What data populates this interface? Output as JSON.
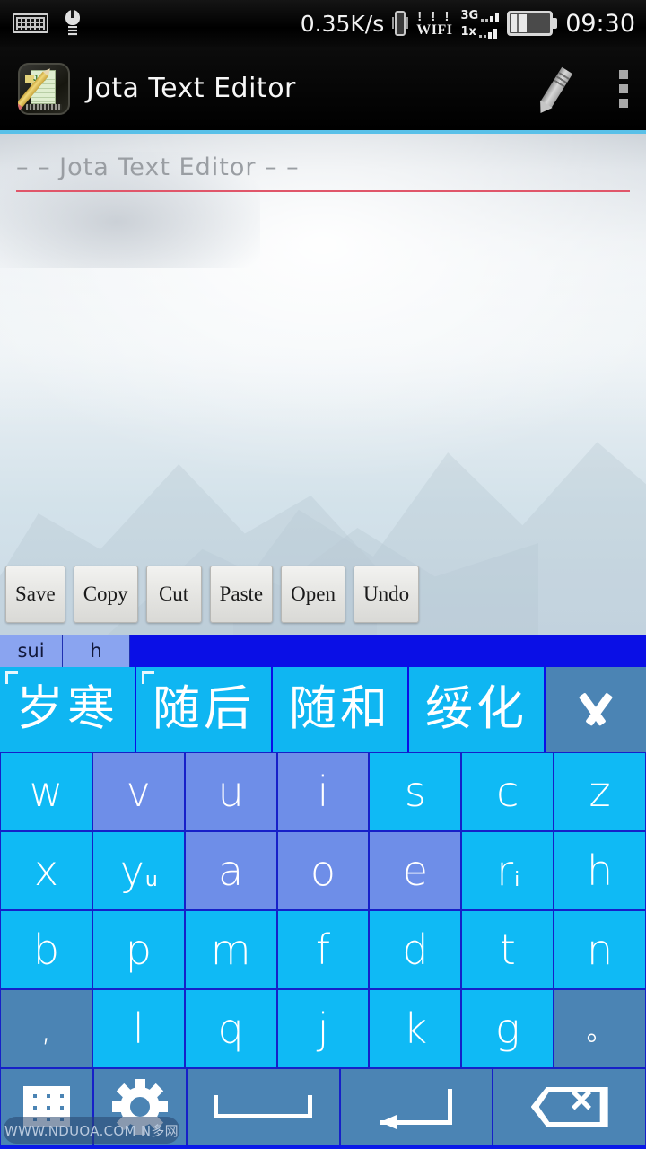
{
  "status_bar": {
    "icons_left": [
      "keyboard-icon",
      "lightbulb-icon"
    ],
    "net_speed": "0.35K/s",
    "vibrate_icon": "vibrate-icon",
    "wifi_bars": "! ! !",
    "wifi_label": "WIFI",
    "sim1_label": "3G",
    "sim2_label": "1x",
    "battery_icon": "battery-icon",
    "clock": "09:30"
  },
  "app_bar": {
    "app_icon": "jota-app-icon",
    "title": "Jota Text Editor",
    "edit_icon": "pencil-icon",
    "overflow_icon": "more-vertical-icon"
  },
  "editor": {
    "document_title": "– – Jota Text Editor – –",
    "body_text": ""
  },
  "action_bar": {
    "buttons": [
      {
        "label": "Save",
        "name": "save-button"
      },
      {
        "label": "Copy",
        "name": "copy-button"
      },
      {
        "label": "Cut",
        "name": "cut-button"
      },
      {
        "label": "Paste",
        "name": "paste-button"
      },
      {
        "label": "Open",
        "name": "open-button"
      },
      {
        "label": "Undo",
        "name": "undo-button"
      }
    ]
  },
  "ime": {
    "composition": [
      "sui",
      "h"
    ],
    "candidates": [
      "岁寒",
      "随后",
      "随和",
      "绥化"
    ],
    "expand_icon": "chevron-down-icon",
    "rows": [
      [
        {
          "main": "w",
          "sub": "",
          "style": "normal"
        },
        {
          "main": "v",
          "sub": "",
          "style": "highlight"
        },
        {
          "main": "u",
          "sub": "",
          "style": "highlight"
        },
        {
          "main": "i",
          "sub": "",
          "style": "highlight"
        },
        {
          "main": "s",
          "sub": "",
          "style": "normal"
        },
        {
          "main": "c",
          "sub": "",
          "style": "normal"
        },
        {
          "main": "z",
          "sub": "",
          "style": "normal"
        }
      ],
      [
        {
          "main": "x",
          "sub": "",
          "style": "normal"
        },
        {
          "main": "y",
          "sub": "u",
          "style": "normal"
        },
        {
          "main": "a",
          "sub": "",
          "style": "highlight"
        },
        {
          "main": "o",
          "sub": "",
          "style": "highlight"
        },
        {
          "main": "e",
          "sub": "",
          "style": "highlight"
        },
        {
          "main": "r",
          "sub": "i",
          "style": "normal"
        },
        {
          "main": "h",
          "sub": "",
          "style": "normal"
        }
      ],
      [
        {
          "main": "b",
          "sub": "",
          "style": "normal"
        },
        {
          "main": "p",
          "sub": "",
          "style": "normal"
        },
        {
          "main": "m",
          "sub": "",
          "style": "normal"
        },
        {
          "main": "f",
          "sub": "",
          "style": "normal"
        },
        {
          "main": "d",
          "sub": "",
          "style": "normal"
        },
        {
          "main": "t",
          "sub": "",
          "style": "normal"
        },
        {
          "main": "n",
          "sub": "",
          "style": "normal"
        }
      ],
      [
        {
          "main": ",",
          "sub": "",
          "style": "function"
        },
        {
          "main": "l",
          "sub": "",
          "style": "normal"
        },
        {
          "main": "q",
          "sub": "",
          "style": "normal"
        },
        {
          "main": "j",
          "sub": "",
          "style": "normal"
        },
        {
          "main": "k",
          "sub": "",
          "style": "normal"
        },
        {
          "main": "g",
          "sub": "",
          "style": "normal"
        },
        {
          "main": "。",
          "sub": "",
          "style": "function"
        }
      ]
    ],
    "function_row": [
      {
        "name": "symbol-grid-key",
        "icon": "grid-icon"
      },
      {
        "name": "settings-key",
        "icon": "gear-icon"
      },
      {
        "name": "space-key",
        "icon": "space-icon"
      },
      {
        "name": "enter-key",
        "icon": "enter-icon"
      },
      {
        "name": "backspace-key",
        "icon": "backspace-icon"
      }
    ]
  },
  "watermark": {
    "text": "WWW.NDUOA.COM N多网"
  },
  "colors": {
    "accent": "#59c0e8",
    "ime_background": "#0a19e8",
    "key_normal": "#0fbaf5",
    "key_highlight": "#6e8ee8",
    "key_function": "#4b84b4",
    "candidate": "#0fb6f2",
    "title_rule": "#e0566a"
  }
}
